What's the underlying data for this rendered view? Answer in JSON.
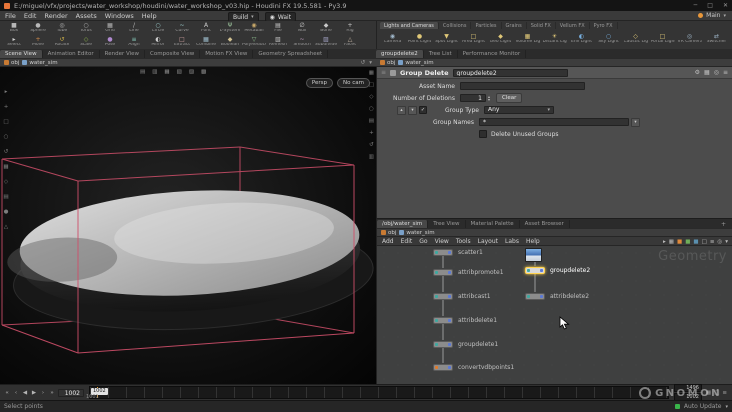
{
  "window": {
    "title": "E:/miguel/vfx/projects/water_workshop/houdini/water_workshop_v03.hip - Houdini FX 19.5.581 - Py3.9",
    "minimize": "─",
    "maximize": "□",
    "close": "✕"
  },
  "glyphs": {
    "caret": "▾",
    "check": "✓",
    "gear": "⚙",
    "refresh": "↺",
    "menu": "≡",
    "pin": "◎",
    "wait_dot": "◉"
  },
  "menubar": {
    "items": [
      "File",
      "Edit",
      "Render",
      "Assets",
      "Windows",
      "Help"
    ],
    "desktop": "Build",
    "wait": "Wait",
    "take": "Main"
  },
  "shelf": {
    "row1": [
      {
        "label": "Box",
        "g": "■",
        "c": "#b8b8b8"
      },
      {
        "label": "Sphere",
        "g": "●",
        "c": "#b8b8b8"
      },
      {
        "label": "Tube",
        "g": "◎",
        "c": "#b8b8b8"
      },
      {
        "label": "Torus",
        "g": "○",
        "c": "#b8b8b8"
      },
      {
        "label": "Grid",
        "g": "▦",
        "c": "#b8b8b8"
      },
      {
        "label": "Line",
        "g": "/",
        "c": "#b8b8b8"
      },
      {
        "label": "Circle",
        "g": "○",
        "c": "#9fd1d1"
      },
      {
        "label": "Curve",
        "g": "~",
        "c": "#9fd1d1"
      },
      {
        "label": "Font",
        "g": "A",
        "c": "#c9c9c9"
      },
      {
        "label": "L-System",
        "g": "Ψ",
        "c": "#9ec79e"
      },
      {
        "label": "Metaball",
        "g": "◉",
        "c": "#c9a96a"
      },
      {
        "label": "File",
        "g": "▤",
        "c": "#c9c9c9"
      },
      {
        "label": "Null",
        "g": "∅",
        "c": "#c9c9c9"
      },
      {
        "label": "Bone",
        "g": "◆",
        "c": "#c9c9c9"
      },
      {
        "label": "Rig",
        "g": "+",
        "c": "#c9c9c9"
      }
    ],
    "row2": [
      {
        "label": "Select",
        "g": "▸",
        "c": "#d0d0d0"
      },
      {
        "label": "Move",
        "g": "+",
        "c": "#d08a4a"
      },
      {
        "label": "Rotate",
        "g": "↺",
        "c": "#d0b24a"
      },
      {
        "label": "Scale",
        "g": "◇",
        "c": "#8ab04a"
      },
      {
        "label": "Pose",
        "g": "●",
        "c": "#b08ad0"
      },
      {
        "label": "Align",
        "g": "≡",
        "c": "#8ad0c0"
      },
      {
        "label": "Mirror",
        "g": "◐",
        "c": "#d0d0d0"
      },
      {
        "label": "Extract",
        "g": "□",
        "c": "#d0a0a0"
      },
      {
        "label": "Combine",
        "g": "▦",
        "c": "#a0c0d0"
      },
      {
        "label": "Boolean",
        "g": "◆",
        "c": "#d0c090"
      },
      {
        "label": "PolyReduce",
        "g": "▽",
        "c": "#90c090"
      },
      {
        "label": "Remesh",
        "g": "▧",
        "c": "#c0c0c0"
      },
      {
        "label": "Smooth",
        "g": "~",
        "c": "#c0a0c0"
      },
      {
        "label": "Subdivide",
        "g": "▨",
        "c": "#a0a0c0"
      },
      {
        "label": "Facet",
        "g": "△",
        "c": "#c0b0a0"
      }
    ],
    "right_tabs": [
      "Lights and Cameras",
      "Collisions",
      "Particles",
      "Grains",
      "Solid FX",
      "Vellum FX",
      "Pyro FX"
    ],
    "lights": [
      {
        "label": "Camera",
        "g": "◉",
        "c": "#9fb6c9"
      },
      {
        "label": "Point Light",
        "g": "●",
        "c": "#e0c878"
      },
      {
        "label": "Spot Light",
        "g": "▼",
        "c": "#e0c878"
      },
      {
        "label": "Area Light",
        "g": "□",
        "c": "#e0c878"
      },
      {
        "label": "Geo Light",
        "g": "◆",
        "c": "#e0c878"
      },
      {
        "label": "Volume Light",
        "g": "▦",
        "c": "#e0c878"
      },
      {
        "label": "Distant Light",
        "g": "☀",
        "c": "#e0c878"
      },
      {
        "label": "Env Light",
        "g": "◐",
        "c": "#78b0e0"
      },
      {
        "label": "Sky Light",
        "g": "○",
        "c": "#78b0e0"
      },
      {
        "label": "Caustic Light",
        "g": "◇",
        "c": "#e0c878"
      },
      {
        "label": "Portal Light",
        "g": "□",
        "c": "#e0c878"
      },
      {
        "label": "VR Camera",
        "g": "◎",
        "c": "#9fb6c9"
      },
      {
        "label": "Switcher",
        "g": "⇄",
        "c": "#9fb6c9"
      }
    ]
  },
  "left_pane": {
    "tabs": [
      "Scene View",
      "Animation Editor",
      "Render View",
      "Composite View",
      "Motion FX View",
      "Geometry Spreadsheet"
    ],
    "path": {
      "context": "obj",
      "node": "water_sim"
    },
    "path_icons": [
      "↺",
      "▾"
    ],
    "viewport": {
      "persp": "Persp",
      "nocam": "No cam",
      "top_tools": [
        "▤",
        "▥",
        "▦",
        "▧",
        "▨",
        "▩"
      ],
      "left_tools": [
        "▸",
        "+",
        "□",
        "○",
        "↺",
        "▦",
        "◇",
        "▤",
        "●",
        "△"
      ],
      "right_tools": [
        "▦",
        "□",
        "◇",
        "○",
        "▤",
        "+",
        "↺",
        "▥"
      ]
    }
  },
  "params": {
    "tabs": [
      "groupdelete2",
      "Tree List",
      "Performance Monitor"
    ],
    "path": {
      "context": "obj",
      "node": "water_sim"
    },
    "node_type": "Group Delete",
    "node_name": "groupdelete2",
    "header_icons": [
      "⚙",
      "▦",
      "◎",
      "≡"
    ],
    "asset_name_label": "Asset Name",
    "asset_name_value": "",
    "deletions_label": "Number of Deletions",
    "deletions_value": "1",
    "clear_label": "Clear",
    "group_type_label": "Group Type",
    "group_type_value": "Any",
    "group_names_label": "Group Names",
    "group_names_value": "*",
    "delete_unused_label": "Delete Unused Groups"
  },
  "network": {
    "tabs": [
      "/obj/water_sim",
      "Tree View",
      "Material Palette",
      "Asset Browser"
    ],
    "new_tab": "+",
    "path": {
      "context": "obj",
      "node": "water_sim"
    },
    "menus": [
      "Add",
      "Edit",
      "Go",
      "View",
      "Tools",
      "Layout",
      "Labs",
      "Help"
    ],
    "toolbar_icons": [
      {
        "g": "▸",
        "c": "#bdbdbd"
      },
      {
        "g": "▦",
        "c": "#bdbdbd"
      },
      {
        "g": "■",
        "c": "#e0893a"
      },
      {
        "g": "■",
        "c": "#6fae5a"
      },
      {
        "g": "■",
        "c": "#5a8fae"
      },
      {
        "g": "□",
        "c": "#bdbdbd"
      },
      {
        "g": "≡",
        "c": "#bdbdbd"
      },
      {
        "g": "◎",
        "c": "#bdbdbd"
      },
      {
        "g": "▾",
        "c": "#bdbdbd"
      }
    ],
    "watermark": "Geometry",
    "nodes": {
      "chain": [
        "scatter1",
        "attribpromote1",
        "attribcast1",
        "attribdelete1",
        "groupdelete1",
        "convertvdbpoints1"
      ],
      "right": [
        "groupdelete2",
        "attribdelete2"
      ]
    }
  },
  "playbar": {
    "transport": [
      "«",
      "‹",
      "◀",
      "▶",
      "›",
      "»"
    ],
    "current_frame": "1002",
    "range_start": "1001",
    "playhead": "1002",
    "range_end": "1496",
    "alt_frame": "1002",
    "right_icons": [
      "▦",
      "□",
      "≡"
    ]
  },
  "statusbar": {
    "message": "Select points",
    "update_mode": "Auto Update"
  },
  "brand": "GNOMON"
}
